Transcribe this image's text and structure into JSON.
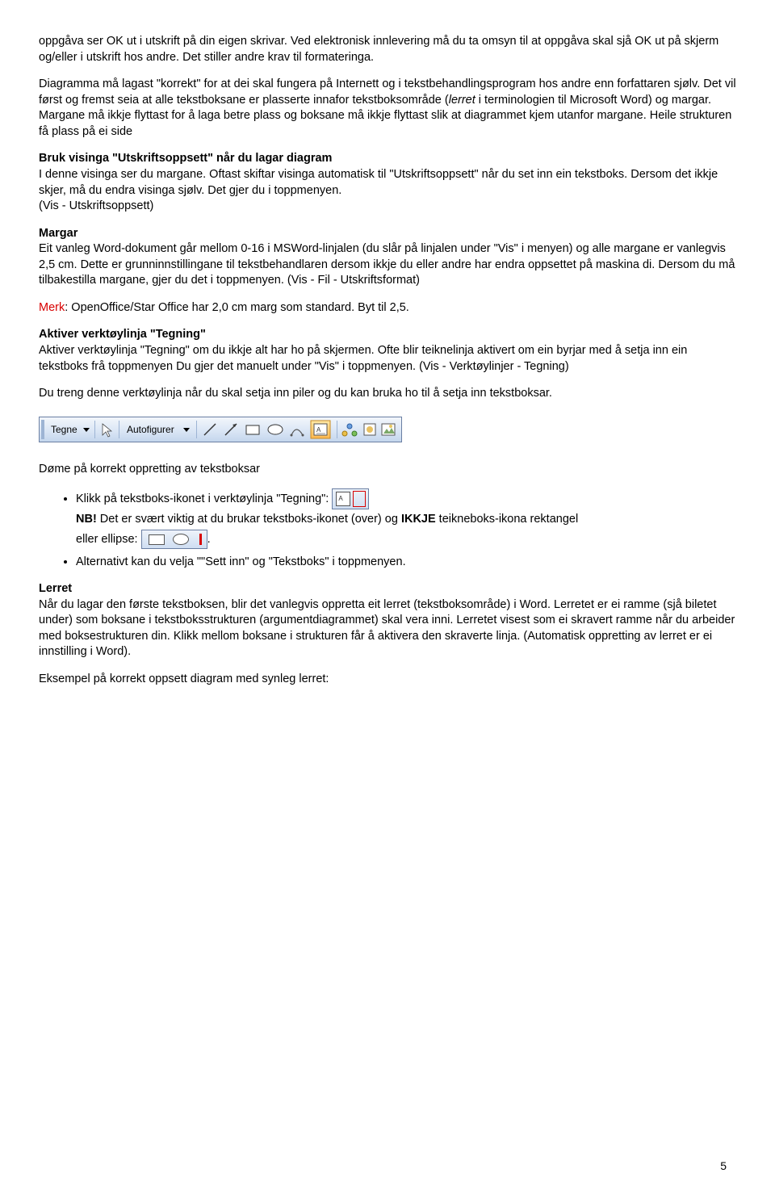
{
  "p1": "oppgåva ser OK ut i utskrift på din eigen skrivar. Ved elektronisk innlevering må du ta omsyn til at oppgåva skal sjå OK ut på skjerm og/eller i utskrift hos andre. Det stiller andre krav til formateringa.",
  "p2a": "Diagramma må lagast \"korrekt\" for at dei skal fungera på Internett og i tekstbehandlingsprogram hos andre enn forfattaren sjølv. Det vil først og fremst seia at alle tekstboksane er plasserte innafor tekstboksområde (",
  "p2b": "lerret",
  "p2c": " i terminologien til Microsoft Word) og margar. Margane må ikkje flyttast for å laga betre plass og boksane må ikkje flyttast slik at diagrammet kjem utanfor margane. Heile strukturen få plass på ei side",
  "h1": "Bruk visinga \"Utskriftsoppsett\" når du lagar diagram",
  "p3": "I denne visinga ser du margane. Oftast skiftar visinga automatisk til \"Utskriftsoppsett\" når du set inn ein tekstboks. Dersom det ikkje skjer, må du endra visinga sjølv. Det gjer du i toppmenyen.",
  "p3a": "(Vis - Utskriftsoppsett)",
  "h2": "Margar",
  "p4": "Eit vanleg Word-dokument går mellom 0-16 i MSWord-linjalen (du slår på linjalen under \"Vis\" i menyen) og alle margane er vanlegvis 2,5 cm. Dette er grunninnstillingane til tekstbehandlaren dersom ikkje du eller andre har endra oppsettet på maskina di. Dersom du må tilbakestilla margane, gjer du det i toppmenyen. (Vis - Fil - Utskriftsformat)",
  "merk_label": "Merk",
  "merk_text": ": OpenOffice/Star Office har 2,0 cm marg som standard. Byt til 2,5.",
  "h3": "Aktiver verktøylinja \"Tegning\"",
  "p5": "Aktiver verktøylinja \"Tegning\" om du ikkje alt har ho på skjermen. Ofte blir teiknelinja aktivert om ein byrjar med å setja inn ein tekstboks frå toppmenyen Du gjer det manuelt under \"Vis\" i toppmenyen. (Vis - Verktøylinjer - Tegning)",
  "p6": "Du treng denne verktøylinja når du skal setja inn piler og du kan bruka ho til å setja inn tekstboksar.",
  "toolbar": {
    "tegne": "Tegne",
    "autofigurer": "Autofigurer"
  },
  "p7": "Døme på korrekt oppretting av tekstboksar",
  "li1": "Klikk på tekstboks-ikonet i verktøylinja \"Tegning\": ",
  "li1b_nb": "NB!",
  "li1b": " Det er svært viktig at du brukar tekstboks-ikonet (over) og ",
  "li1b_ikkje": "IKKJE",
  "li1b2": " teikneboks-ikona rektangel",
  "li1c": "eller ellipse: ",
  "li1d": ".",
  "li2": "Alternativt kan du velja \"\"Sett inn\" og \"Tekstboks\" i toppmenyen.",
  "h4": "Lerret",
  "p8": "Når du lagar den første tekstboksen, blir det vanlegvis oppretta eit lerret (tekstboksområde) i Word. Lerretet er ei ramme (sjå biletet under) som boksane i tekstboksstrukturen (argumentdiagrammet) skal vera inni. Lerretet visest som ei skravert ramme når du arbeider med boksestrukturen din. Klikk mellom boksane i strukturen får å aktivera den skraverte linja. (Automatisk oppretting av lerret er ei innstilling i Word).",
  "p9": "Eksempel på korrekt oppsett diagram med synleg lerret:",
  "page_number": "5"
}
